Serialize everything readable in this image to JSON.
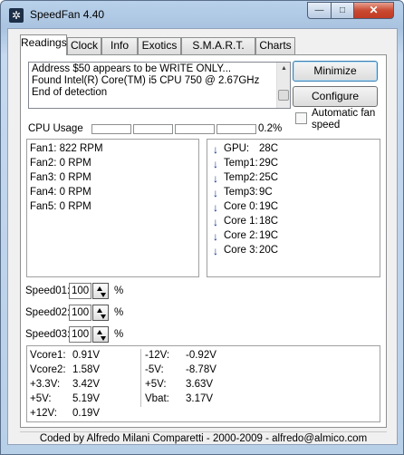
{
  "window": {
    "title": "SpeedFan 4.40",
    "app_icon": "fan-icon",
    "minimize": "—",
    "maximize": "□",
    "close": "✕"
  },
  "tabs": [
    "Readings",
    "Clock",
    "Info",
    "Exotics",
    "S.M.A.R.T.",
    "Charts"
  ],
  "active_tab": "Readings",
  "log": [
    "Address $50 appears to be WRITE ONLY...",
    "Found Intel(R) Core(TM) i5 CPU 750 @ 2.67GHz",
    "End of detection"
  ],
  "buttons": {
    "minimize": "Minimize",
    "configure": "Configure"
  },
  "auto_fan": {
    "label": "Automatic fan speed",
    "checked": false
  },
  "cpu": {
    "label": "CPU Usage",
    "value": "0.2%",
    "bars": [
      0,
      0,
      0,
      0
    ]
  },
  "fans": [
    "Fan1: 822 RPM",
    "Fan2: 0 RPM",
    "Fan3: 0 RPM",
    "Fan4: 0 RPM",
    "Fan5: 0 RPM"
  ],
  "temps": [
    {
      "name": "GPU:",
      "value": "28C",
      "trend": "down"
    },
    {
      "name": "Temp1:",
      "value": "29C",
      "trend": "down"
    },
    {
      "name": "Temp2:",
      "value": "25C",
      "trend": "down"
    },
    {
      "name": "Temp3:",
      "value": "9C",
      "trend": "down"
    },
    {
      "name": "Core 0:",
      "value": "19C",
      "trend": "down"
    },
    {
      "name": "Core 1:",
      "value": "18C",
      "trend": "down"
    },
    {
      "name": "Core 2:",
      "value": "19C",
      "trend": "down"
    },
    {
      "name": "Core 3:",
      "value": "20C",
      "trend": "down"
    }
  ],
  "speeds": [
    {
      "label": "Speed01:",
      "value": "100",
      "unit": "%"
    },
    {
      "label": "Speed02:",
      "value": "100",
      "unit": "%"
    },
    {
      "label": "Speed03:",
      "value": "100",
      "unit": "%"
    }
  ],
  "voltages_left": [
    {
      "name": "Vcore1:",
      "value": "0.91V"
    },
    {
      "name": "Vcore2:",
      "value": "1.58V"
    },
    {
      "name": "+3.3V:",
      "value": "3.42V"
    },
    {
      "name": "+5V:",
      "value": "5.19V"
    },
    {
      "name": "+12V:",
      "value": "0.19V"
    }
  ],
  "voltages_right": [
    {
      "name": "-12V:",
      "value": "-0.92V"
    },
    {
      "name": "-5V:",
      "value": "-8.78V"
    },
    {
      "name": "+5V:",
      "value": "3.63V"
    },
    {
      "name": "Vbat:",
      "value": "3.17V"
    }
  ],
  "status": "Coded by Alfredo Milani Comparetti - 2000-2009 - alfredo@almico.com"
}
